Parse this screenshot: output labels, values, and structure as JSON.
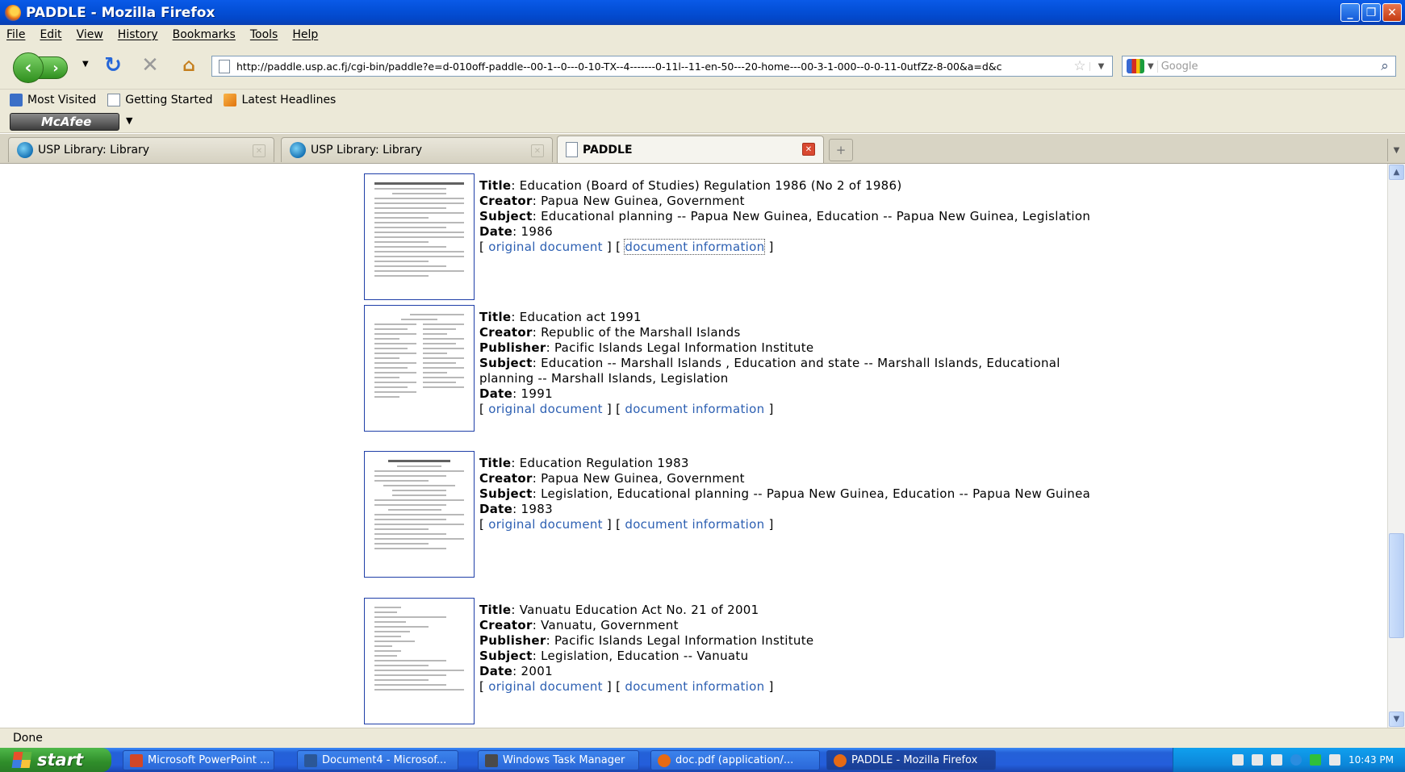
{
  "window": {
    "title": "PADDLE - Mozilla Firefox"
  },
  "menu": [
    "File",
    "Edit",
    "View",
    "History",
    "Bookmarks",
    "Tools",
    "Help"
  ],
  "nav": {
    "url": "http://paddle.usp.ac.fj/cgi-bin/paddle?e=d-010off-paddle--00-1--0---0-10-TX--4-------0-11l--11-en-50---20-home---00-3-1-000--0-0-11-0utfZz-8-00&a=d&c",
    "search_placeholder": "Google"
  },
  "bookmarks": [
    "Most Visited",
    "Getting Started",
    "Latest Headlines"
  ],
  "toolbar": {
    "mcafee_label": "McAfee"
  },
  "tabs": [
    {
      "label": "USP Library: Library"
    },
    {
      "label": "USP Library: Library"
    },
    {
      "label": "PADDLE"
    }
  ],
  "records": [
    {
      "title_label": "Title",
      "title": "Education (Board of Studies) Regulation 1986 (No 2 of 1986)",
      "creator_label": "Creator",
      "creator": "Papua New Guinea, Government",
      "publisher_label": "",
      "publisher": "",
      "subject_label": "Subject",
      "subject": "Educational planning -- Papua New Guinea, Education -- Papua New Guinea, Legislation",
      "date_label": "Date",
      "date": "1986",
      "original_link": "original document",
      "info_link": "document information"
    },
    {
      "title_label": "Title",
      "title": "Education act 1991",
      "creator_label": "Creator",
      "creator": "Republic of the Marshall Islands",
      "publisher_label": "Publisher",
      "publisher": "Pacific Islands Legal Information Institute",
      "subject_label": "Subject",
      "subject": "Education -- Marshall Islands , Education and state -- Marshall Islands, Educational planning -- Marshall Islands, Legislation",
      "date_label": "Date",
      "date": "1991",
      "original_link": "original document",
      "info_link": "document information"
    },
    {
      "title_label": "Title",
      "title": "Education Regulation 1983",
      "creator_label": "Creator",
      "creator": "Papua New Guinea, Government",
      "publisher_label": "",
      "publisher": "",
      "subject_label": "Subject",
      "subject": "Legislation, Educational planning -- Papua New Guinea, Education -- Papua New Guinea",
      "date_label": "Date",
      "date": "1983",
      "original_link": "original document",
      "info_link": "document information"
    },
    {
      "title_label": "Title",
      "title": "Vanuatu Education Act No. 21 of 2001",
      "creator_label": "Creator",
      "creator": "Vanuatu, Government",
      "publisher_label": "Publisher",
      "publisher": "Pacific Islands Legal Information Institute",
      "subject_label": "Subject",
      "subject": "Legislation, Education -- Vanuatu",
      "date_label": "Date",
      "date": "2001",
      "original_link": "original document",
      "info_link": "document information"
    }
  ],
  "status": {
    "text": "Done"
  },
  "taskbar": {
    "start_label": "start",
    "tasks": [
      {
        "label": "Microsoft PowerPoint ...",
        "color": "#d24726"
      },
      {
        "label": "Document4 - Microsof...",
        "color": "#2b5797"
      },
      {
        "label": "Windows Task Manager",
        "color": "#4a4a4a"
      },
      {
        "label": "doc.pdf (application/...",
        "color": "#e66a13"
      },
      {
        "label": "PADDLE - Mozilla Firefox",
        "color": "#e66a13"
      }
    ],
    "clock": "10:43 PM"
  },
  "colors": {
    "link": "#2c5fb2",
    "titlebar": "#0450d8",
    "chrome": "#ece9d8"
  }
}
